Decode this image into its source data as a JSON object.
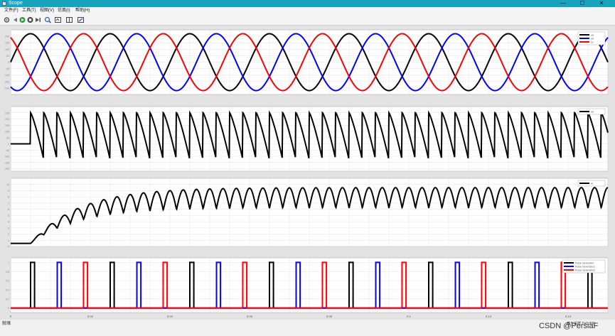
{
  "window": {
    "title": "Scope",
    "minimize": "—",
    "maximize": "☐",
    "close": "✕"
  },
  "menu": [
    "文件(F)",
    "工具(T)",
    "视图(V)",
    "仿真(I)",
    "帮助(H)"
  ],
  "toolbar": [
    "settings-icon",
    "back-icon",
    "run-icon",
    "stop-icon",
    "step-icon",
    "zoom-icon",
    "autoscale-icon",
    "cursor-icon",
    "style-icon"
  ],
  "x_ticks": [
    "0",
    "0.02",
    "0.04",
    "0.06",
    "0.08",
    "0.1",
    "0.12",
    "0.14"
  ],
  "colors": {
    "black": "#000000",
    "blue": "#0000ff",
    "red": "#ff0000"
  },
  "chart_data": [
    {
      "type": "line",
      "title": "",
      "xlim": [
        0,
        0.15
      ],
      "ylim": [
        -250,
        250
      ],
      "y_ticks": [
        "200",
        "150",
        "100",
        "50",
        "0",
        "-50",
        "-100",
        "-150",
        "-200"
      ],
      "series": [
        {
          "name": "ua",
          "color": "#000000",
          "amplitude": 220,
          "frequency_hz": 50,
          "phase_deg": 0
        },
        {
          "name": "ub",
          "color": "#0000ff",
          "amplitude": 220,
          "frequency_hz": 50,
          "phase_deg": -120
        },
        {
          "name": "uc",
          "color": "#ff0000",
          "amplitude": 220,
          "frequency_hz": 50,
          "phase_deg": 120
        }
      ],
      "legend": [
        "ua",
        "ub",
        "uc"
      ]
    },
    {
      "type": "line",
      "title": "",
      "xlim": [
        0,
        0.15
      ],
      "ylim": [
        -220,
        300
      ],
      "y_ticks": [
        "250",
        "200",
        "150",
        "100",
        "50",
        "0",
        "-50",
        "-100",
        "-150",
        "-200"
      ],
      "series": [
        {
          "name": "ud",
          "color": "#000000"
        }
      ],
      "legend": [
        "ud"
      ],
      "note_pre_start_value": 0,
      "start_time": 0.005
    },
    {
      "type": "line",
      "title": "",
      "xlim": [
        0,
        0.15
      ],
      "ylim": [
        0,
        11
      ],
      "y_ticks": [
        "10",
        "9",
        "8",
        "7",
        "6",
        "5",
        "4",
        "3",
        "2",
        "1",
        "0"
      ],
      "series": [
        {
          "name": "id",
          "color": "#000000"
        }
      ],
      "legend": [
        "id"
      ],
      "start_time": 0.005
    },
    {
      "type": "line",
      "title": "",
      "xlim": [
        0,
        0.15
      ],
      "ylim": [
        -0.1,
        1.1
      ],
      "y_ticks": [
        "1",
        "0.8",
        "0.6",
        "0.4",
        "0.2",
        "0"
      ],
      "series": [
        {
          "name": "Pulse Generator",
          "color": "#000000",
          "pulse_times": [
            0.005,
            0.025,
            0.045,
            0.065,
            0.085,
            0.105,
            0.125,
            0.145
          ],
          "pulse_width": 0.001
        },
        {
          "name": "Pulse Generator1",
          "color": "#0000ff",
          "pulse_times": [
            0.0117,
            0.0317,
            0.0517,
            0.0717,
            0.0917,
            0.1117,
            0.1317
          ],
          "pulse_width": 0.001
        },
        {
          "name": "Pulse Generator2",
          "color": "#ff0000",
          "pulse_times": [
            0.0183,
            0.0383,
            0.0583,
            0.0783,
            0.0983,
            0.1183,
            0.1383
          ],
          "pulse_width": 0.001
        }
      ],
      "legend": [
        "Pulse Generator",
        "Pulse Generator1",
        "Pulse Generator2"
      ]
    }
  ],
  "status": {
    "left": "就绪",
    "right": "基于采样   T=1.000"
  },
  "watermark": "CSDN @PersiaF"
}
